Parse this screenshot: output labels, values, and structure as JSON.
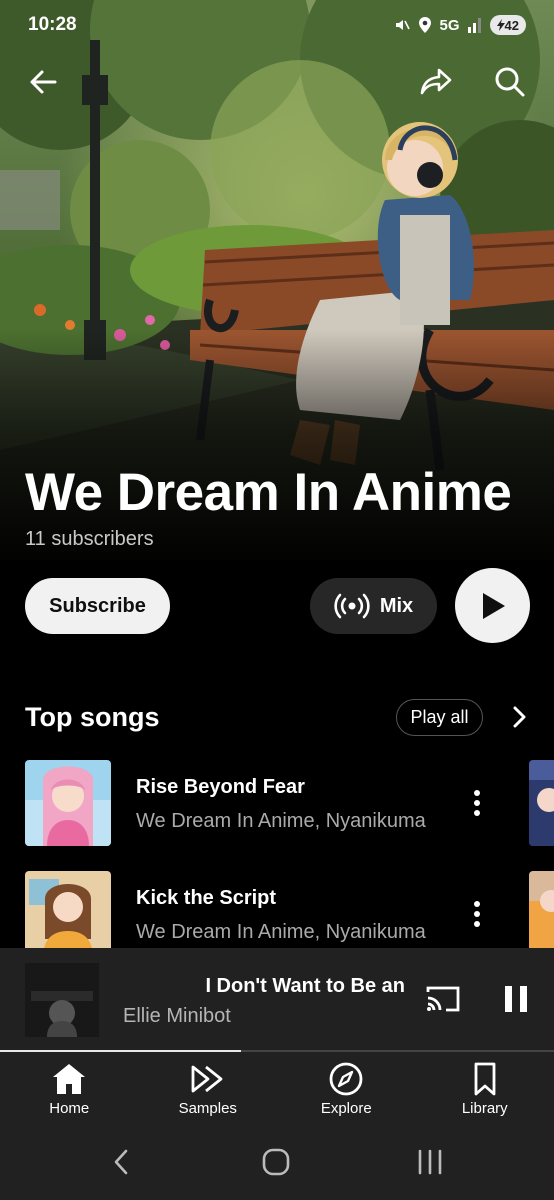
{
  "status_bar": {
    "time": "10:28",
    "network": "5G",
    "battery": "42"
  },
  "header": {
    "back_icon": "arrow-left-icon",
    "share_icon": "share-icon",
    "search_icon": "search-icon"
  },
  "artist": {
    "name": "We Dream In Anime",
    "subscribers": "11 subscribers"
  },
  "actions": {
    "subscribe_label": "Subscribe",
    "mix_label": "Mix",
    "play_icon": "play-icon"
  },
  "top_songs": {
    "title": "Top songs",
    "play_all_label": "Play all",
    "songs": [
      {
        "title": "Rise Beyond Fear",
        "artist": "We Dream In Anime, Nyanikuma"
      },
      {
        "title": "Kick the Script",
        "artist": "We Dream In Anime, Nyanikuma"
      }
    ]
  },
  "now_playing": {
    "title": "I Don't Want to Be an",
    "artist": "Ellie Minibot",
    "progress": 0.435
  },
  "bottom_nav": [
    {
      "label": "Home",
      "icon": "home-icon",
      "active": true
    },
    {
      "label": "Samples",
      "icon": "samples-icon"
    },
    {
      "label": "Explore",
      "icon": "compass-icon"
    },
    {
      "label": "Library",
      "icon": "bookmark-icon"
    }
  ],
  "colors": {
    "background": "#000000",
    "panel": "#212121",
    "chip": "#272727",
    "button_light": "#f1f1f1",
    "secondary_text": "#aaaaaa"
  }
}
